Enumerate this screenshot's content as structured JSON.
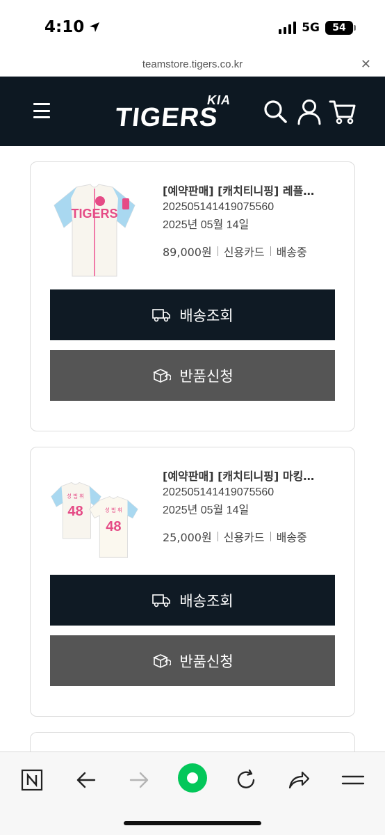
{
  "status_bar": {
    "time": "4:10",
    "network": "5G",
    "battery": "54"
  },
  "url_bar": {
    "url": "teamstore.tigers.co.kr"
  },
  "header": {
    "logo_kia": "KIA",
    "logo_main": "TIGERS"
  },
  "orders": [
    {
      "product_name": "[예약판매] [캐치티니핑] 레플…",
      "order_number": "20250514141907556​0",
      "order_date": "2025년 05월 14일",
      "price": "89,000원",
      "payment": "신용카드",
      "status": "배송중",
      "track_label": "배송조회",
      "return_label": "반품신청"
    },
    {
      "product_name": "[예약판매] [캐치티니핑] 마킹…",
      "order_number": "202505141419075560",
      "order_date": "2025년 05월 14일",
      "price": "25,000원",
      "payment": "신용카드",
      "status": "배송중",
      "track_label": "배송조회",
      "return_label": "반품신청"
    }
  ],
  "icons": {
    "menu": "hamburger-menu-icon",
    "search": "search-icon",
    "account": "user-icon",
    "cart": "cart-icon",
    "track": "delivery-truck-icon",
    "return": "return-box-icon"
  },
  "colors": {
    "header_bg": "#0d1822",
    "track_button": "#0f1a24",
    "return_button": "#555555",
    "toolbar_accent": "#03c75a"
  }
}
